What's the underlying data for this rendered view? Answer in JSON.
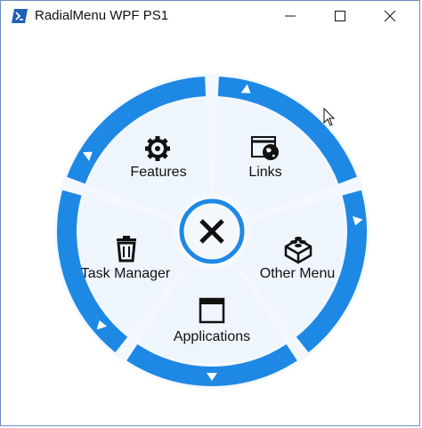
{
  "window": {
    "title": "RadialMenu WPF PS1",
    "accent": "#1e88e5",
    "sector_fill": "#eef5fd"
  },
  "menu": {
    "center": {
      "icon": "close-x-icon"
    },
    "items": [
      {
        "label": "Links",
        "icon": "globe-window-icon"
      },
      {
        "label": "Other Menu",
        "icon": "lego-brick-icon"
      },
      {
        "label": "Applications",
        "icon": "window-app-icon"
      },
      {
        "label": "Task Manager",
        "icon": "trash-icon"
      },
      {
        "label": "Features",
        "icon": "gear-icon"
      }
    ]
  }
}
